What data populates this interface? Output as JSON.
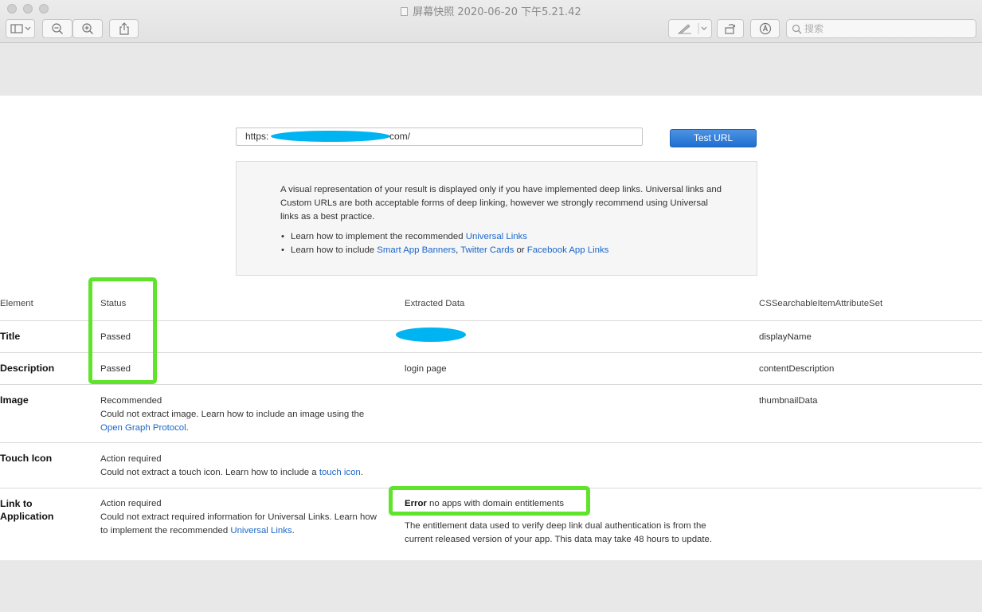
{
  "window": {
    "title": "屏幕快照 2020-06-20 下午5.21.42",
    "search_placeholder": "搜索"
  },
  "colors": {
    "accent": "#1f6fd0",
    "link": "#1b66c9",
    "highlight": "#5fe32b",
    "redaction": "#00b4f2"
  },
  "icons": [
    "sidebar-icon",
    "chevron-down-icon",
    "zoom-out-icon",
    "zoom-in-icon",
    "share-icon",
    "pen-icon",
    "rotate-icon",
    "markup-icon",
    "search-icon"
  ],
  "page": {
    "url_prefix": "https:",
    "url_suffix": "com/",
    "test_button": "Test URL",
    "info": {
      "paragraph": "A visual representation of your result is displayed only if you have implemented deep links. Universal links and Custom URLs are both acceptable forms of deep linking, however we strongly recommend using Universal links as a best practice.",
      "item1_text": "Learn how to implement the recommended ",
      "item1_link": "Universal Links",
      "item2_text": "Learn how to include ",
      "item2_link1": "Smart App Banners",
      "item2_sep1": ", ",
      "item2_link2": "Twitter Cards",
      "item2_sep2": " or ",
      "item2_link3": "Facebook App Links"
    }
  },
  "table": {
    "headers": {
      "element": "Element",
      "status": "Status",
      "data": "Extracted Data",
      "attr": "CSSearchableItemAttributeSet"
    },
    "rows": [
      {
        "element": "Title",
        "status": "Passed",
        "data": "",
        "attr": "displayName"
      },
      {
        "element": "Description",
        "status": "Passed",
        "data": "login page",
        "attr": "contentDescription"
      },
      {
        "element": "Image",
        "status": "Recommended",
        "detail": "Could not extract image. Learn how to include an image using the ",
        "link": "Open Graph Protocol",
        "tail": ".",
        "attr": "thumbnailData"
      },
      {
        "element": "Touch Icon",
        "status": "Action required",
        "detail": "Could not extract a touch icon. Learn how to include a ",
        "link": "touch icon",
        "tail": "."
      },
      {
        "element_line1": "Link to",
        "element_line2": "Application",
        "status": "Action required",
        "detail": "Could not extract required information for Universal Links. Learn how to implement the recommended ",
        "link": "Universal Links",
        "tail": ".",
        "error_label": "Error",
        "error_text": " no apps with domain entitlements",
        "note": "The entitlement data used to verify deep link dual authentication is from the current released version of your app. This data may take 48 hours to update."
      }
    ]
  }
}
